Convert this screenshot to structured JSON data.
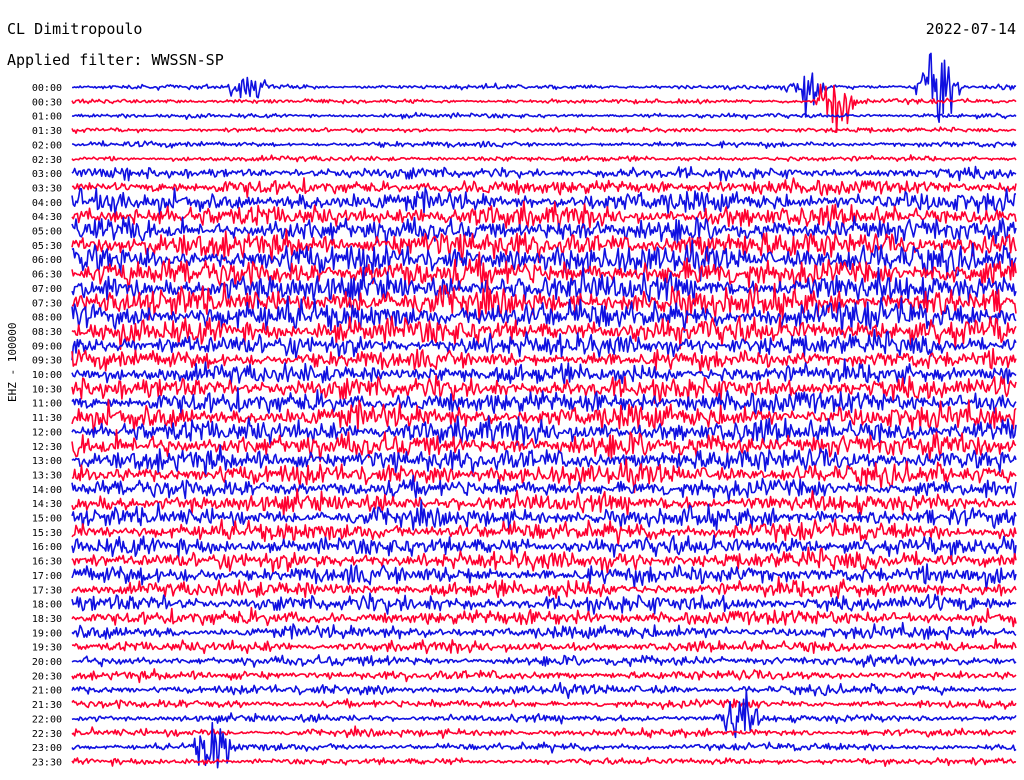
{
  "header": {
    "station": "CL Dimitropoulo",
    "date": "2022-07-14",
    "filter": "Applied filter: WWSSN-SP"
  },
  "axis": {
    "ylabel": "EHZ - 100000"
  },
  "colors": {
    "trace_a": "#1010e0",
    "trace_b": "#ff0030",
    "background": "#ffffff",
    "text": "#000000"
  },
  "chart_data": {
    "type": "line",
    "description_kind": "helicorder",
    "rows": [
      "00:00",
      "00:30",
      "01:00",
      "01:30",
      "02:00",
      "02:30",
      "03:00",
      "03:30",
      "04:00",
      "04:30",
      "05:00",
      "05:30",
      "06:00",
      "06:30",
      "07:00",
      "07:30",
      "08:00",
      "08:30",
      "09:00",
      "09:30",
      "10:00",
      "10:30",
      "11:00",
      "11:30",
      "12:00",
      "12:30",
      "13:00",
      "13:30",
      "14:00",
      "14:30",
      "15:00",
      "15:30",
      "16:00",
      "16:30",
      "17:00",
      "17:30",
      "18:00",
      "18:30",
      "19:00",
      "19:30",
      "20:00",
      "20:30",
      "21:00",
      "21:30",
      "22:00",
      "22:30",
      "23:00",
      "23:30"
    ],
    "row_minutes": 30,
    "color_cycle": [
      "trace_a",
      "trace_b"
    ],
    "row_activity": [
      0.5,
      0.5,
      0.5,
      0.5,
      0.6,
      0.6,
      1.2,
      1.6,
      2.2,
      2.4,
      2.6,
      2.8,
      3.0,
      3.0,
      3.0,
      3.0,
      3.0,
      2.8,
      2.4,
      2.0,
      2.2,
      2.4,
      2.4,
      2.6,
      2.6,
      2.6,
      2.4,
      2.2,
      2.0,
      2.0,
      2.0,
      2.0,
      2.0,
      2.0,
      2.0,
      1.8,
      1.8,
      1.6,
      1.4,
      1.2,
      1.1,
      1.0,
      1.0,
      0.9,
      0.8,
      0.8,
      0.8,
      0.7
    ],
    "events": [
      {
        "row": "00:00",
        "minute": 27.5,
        "amplitude": 9
      },
      {
        "row": "00:00",
        "minute": 5.6,
        "amplitude": 3
      },
      {
        "row": "00:00",
        "minute": 23.3,
        "amplitude": 4
      },
      {
        "row": "00:30",
        "minute": 24.3,
        "amplitude": 6
      },
      {
        "row": "22:00",
        "minute": 21.2,
        "amplitude": 5
      },
      {
        "row": "23:00",
        "minute": 4.5,
        "amplitude": 5
      }
    ]
  }
}
